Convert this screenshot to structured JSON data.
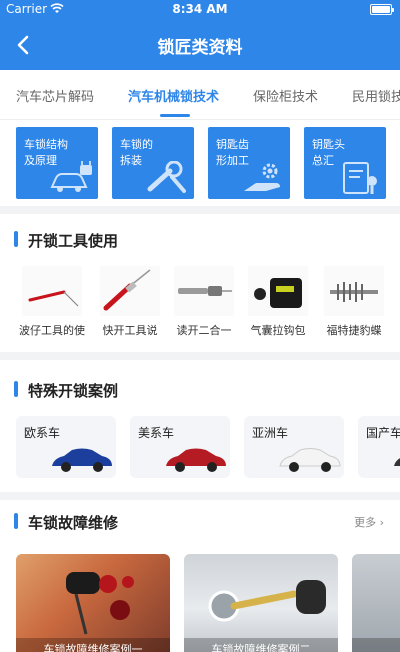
{
  "status": {
    "carrier": "Carrier",
    "time": "8:34 AM"
  },
  "header": {
    "title": "锁匠类资料"
  },
  "tabs": [
    {
      "label": "汽车芯片解码",
      "active": false
    },
    {
      "label": "汽车机械锁技术",
      "active": true
    },
    {
      "label": "保险柜技术",
      "active": false
    },
    {
      "label": "民用锁技",
      "active": false
    }
  ],
  "categories": [
    {
      "label": "车锁结构\n及原理",
      "icon": "car-lock-icon"
    },
    {
      "label": "车锁的\n拆装",
      "icon": "wrench-icon"
    },
    {
      "label": "钥匙齿\n形加工",
      "icon": "gear-hand-icon"
    },
    {
      "label": "钥匙头\n总汇",
      "icon": "document-key-icon"
    }
  ],
  "tools_section": {
    "title": "开锁工具使用",
    "items": [
      {
        "caption": "波仔工具的使"
      },
      {
        "caption": "快开工具说"
      },
      {
        "caption": "读开二合一"
      },
      {
        "caption": "气囊拉钩包"
      },
      {
        "caption": "福特捷豹蝶"
      }
    ]
  },
  "cases_section": {
    "title": "特殊开锁案例",
    "items": [
      {
        "label": "欧系车",
        "car_color": "#1c3f9e"
      },
      {
        "label": "美系车",
        "car_color": "#b51b22"
      },
      {
        "label": "亚洲车",
        "car_color": "#eeeeee"
      },
      {
        "label": "国产车",
        "car_color": "#333333"
      }
    ]
  },
  "repair_section": {
    "title": "车锁故障维修",
    "more": "更多",
    "items": [
      {
        "caption": "车锁故障维修案例一"
      },
      {
        "caption": "车锁故障维修案例二"
      },
      {
        "caption": "车锁"
      }
    ]
  },
  "colors": {
    "primary": "#2e86e8",
    "background": "#f2f3f5"
  }
}
